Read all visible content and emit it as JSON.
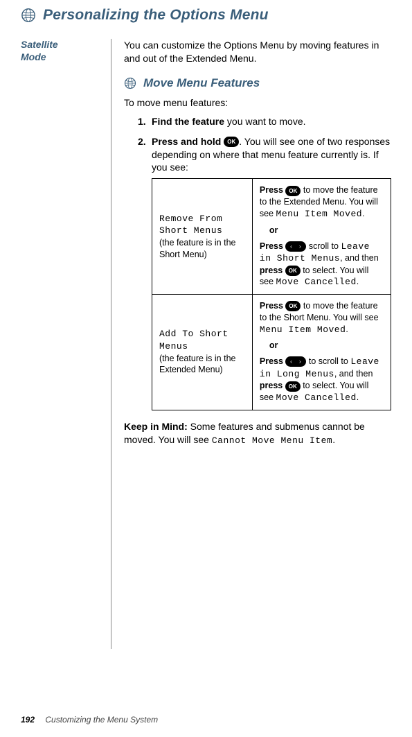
{
  "header": {
    "title": "Personalizing the Options Menu"
  },
  "sidebar": {
    "label_line1": "Satellite",
    "label_line2": "Mode"
  },
  "intro": "You can customize the Options Menu by moving features in and out of the Extended Menu.",
  "section": {
    "title": "Move Menu Features",
    "lead": "To move menu features:"
  },
  "steps": {
    "s1": {
      "num": "1.",
      "bold": "Find the feature",
      "rest": " you want to move."
    },
    "s2": {
      "num": "2.",
      "bold": "Press and hold ",
      "rest": ". You will see one of two responses depending on where that menu feature currently is. If you see:"
    }
  },
  "ok_label": "OK",
  "arrow_label": "‹  ›",
  "table": {
    "row1": {
      "left_lcd": "Remove From Short Menus",
      "left_note": "(the feature is in the Short Menu)",
      "r_a1": "Press ",
      "r_a2": " to move the feature to the Extended Menu. You will see ",
      "r_a_lcd": "Menu Item Moved",
      "or": "or",
      "r_b1": "Press ",
      "r_b2": " scroll to ",
      "r_b_lcd1": "Leave in Short Menus",
      "r_b3": ", and then ",
      "r_b_bold": "press",
      "r_b4": " ",
      "r_b5": " to select. You will see ",
      "r_b_lcd2": "Move Cancelled"
    },
    "row2": {
      "left_lcd": "Add To Short Menus",
      "left_note": "(the feature is in the Extended Menu)",
      "r_a1": "Press ",
      "r_a2": " to move the feature to the Short Menu. You will see ",
      "r_a_lcd": "Menu Item Moved",
      "or": "or",
      "r_b1": "Press ",
      "r_b2": " to scroll to ",
      "r_b_lcd1": "Leave in Long Menus",
      "r_b3": ", and then ",
      "r_b_bold": "press",
      "r_b4": " ",
      "r_b5": " to select. You will see ",
      "r_b_lcd2": "Move Cancelled"
    }
  },
  "keep": {
    "bold": "Keep in Mind:",
    "text": " Some features and submenus cannot be moved. You will see ",
    "lcd": "Cannot Move Menu Item"
  },
  "footer": {
    "page": "192",
    "chapter": "Customizing the Menu System"
  }
}
